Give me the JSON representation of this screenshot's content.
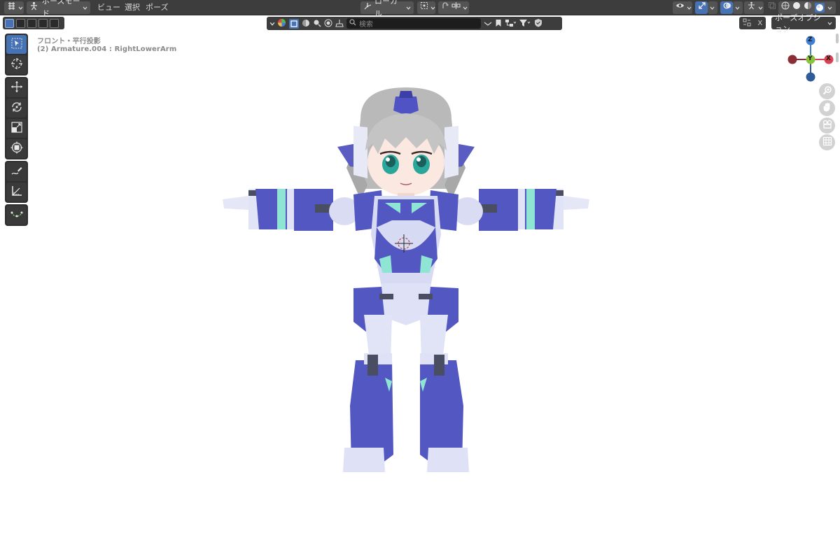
{
  "header": {
    "mode_label": "ポーズモード",
    "menus": [
      "ビュー",
      "選択",
      "ポーズ"
    ],
    "transform_orientation": "ローカル"
  },
  "subbar": {
    "search_placeholder": "検索",
    "close_label": "X",
    "pose_options_label": "ポーズオプション"
  },
  "viewport": {
    "view_name": "フロント・平行投影",
    "active_object": "(2) Armature.004 : RightLowerArm"
  },
  "gizmo": {
    "z_label": "Z",
    "y_label": "Y",
    "x_label": "X",
    "colors": {
      "x": "#d8424e",
      "y": "#8bc43a",
      "z": "#3f7fd4"
    }
  },
  "toolbar": {
    "tools": [
      "select-box",
      "cursor",
      "move",
      "rotate",
      "scale",
      "transform",
      "annotate",
      "measure",
      "relax-pose"
    ]
  },
  "colors": {
    "accent": "#4772b3"
  }
}
